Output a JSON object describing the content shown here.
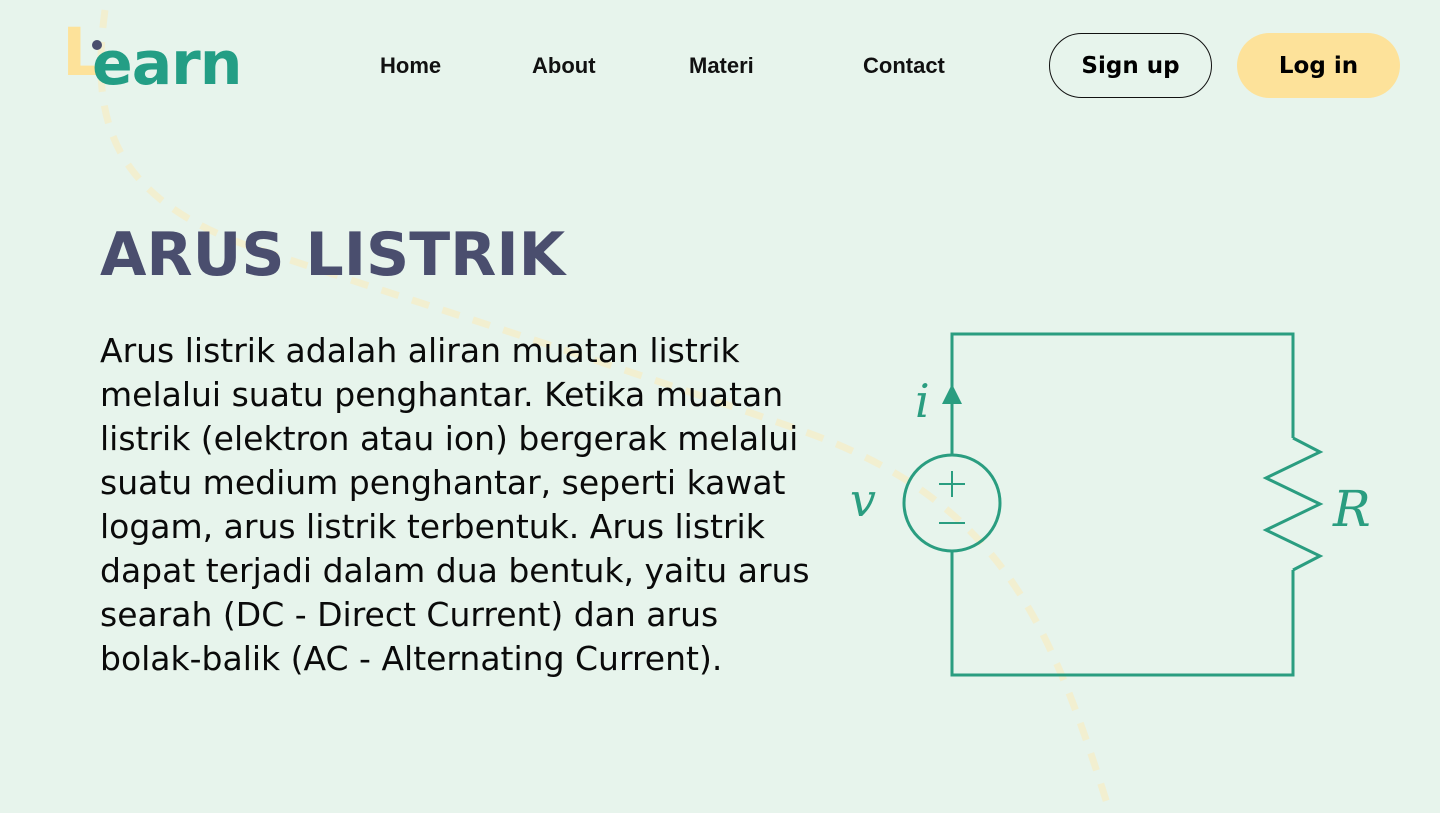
{
  "brand": {
    "logo_first": "L",
    "logo_rest": "earn"
  },
  "nav": [
    {
      "label": "Home"
    },
    {
      "label": "About"
    },
    {
      "label": "Materi"
    },
    {
      "label": "Contact"
    }
  ],
  "auth": {
    "signup_label": "Sign up",
    "login_label": "Log in"
  },
  "content": {
    "title": "ARUS LISTRIK",
    "paragraph": "Arus listrik adalah aliran muatan listrik melalui suatu penghantar. Ketika muatan listrik (elektron atau ion) bergerak melalui suatu medium penghantar, seperti kawat logam, arus listrik terbentuk. Arus listrik dapat terjadi dalam dua bentuk, yaitu arus searah (DC - Direct Current) dan arus bolak-balik (AC - Alternating Current)."
  },
  "circuit": {
    "current_label": "i",
    "voltage_label": "v",
    "resistor_label": "R",
    "plus_sign": "+",
    "minus_sign": "−"
  },
  "colors": {
    "background": "#e7f4ec",
    "brand_green": "#239e85",
    "brand_yellow": "#fde29a",
    "title_color": "#4a4e6e",
    "circuit_color": "#2a9d80"
  }
}
